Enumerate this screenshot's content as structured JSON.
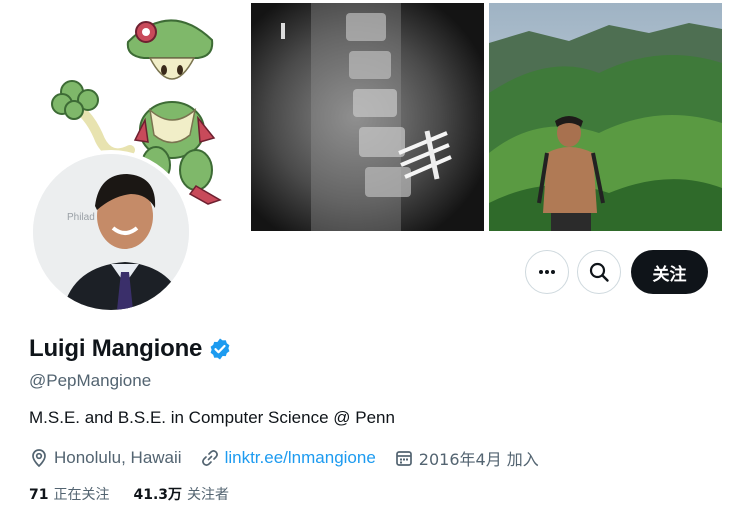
{
  "profile": {
    "display_name": "Luigi Mangione",
    "handle": "@PepMangione",
    "bio": "M.S.E. and B.S.E. in Computer Science @ Penn",
    "location": "Honolulu, Hawaii",
    "link": "linktr.ee/lnmangione",
    "joined": "2016年4月 加入",
    "verified": true
  },
  "avatar_background_text": "Philad Museu",
  "actions": {
    "more": "more-icon",
    "search": "search-icon",
    "follow_label": "关注"
  },
  "stats": {
    "following_count": "71",
    "following_label": "正在关注",
    "followers_count": "41.3万",
    "followers_label": "关注者"
  },
  "colors": {
    "accent": "#1d9bf0",
    "text_primary": "#0f1419",
    "text_secondary": "#536471",
    "follow_bg": "#0f1419",
    "border": "#cfd9de"
  }
}
